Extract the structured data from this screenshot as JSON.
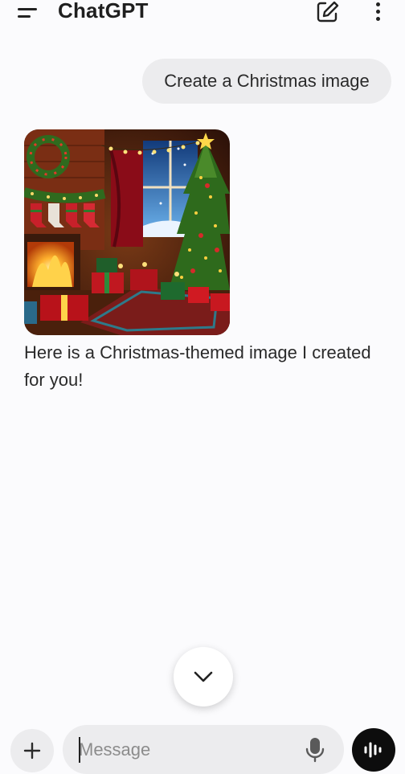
{
  "header": {
    "title": "ChatGPT",
    "icons": {
      "menu": "menu-icon",
      "new_chat": "edit-icon",
      "more": "more-vertical-icon"
    }
  },
  "conversation": {
    "user_message": "Create a Christmas image",
    "assistant_text": "Here is a Christmas-themed image I created for you!",
    "image_subject": "christmas-living-room-illustration"
  },
  "composer": {
    "placeholder": "Message",
    "icons": {
      "attach": "plus-icon",
      "dictate": "microphone-icon",
      "voice": "voice-waveform-icon",
      "scroll": "chevron-down-icon"
    }
  },
  "colors": {
    "background": "#fbfbfd",
    "bubble": "#ececee",
    "voice_button": "#0d0d0d"
  }
}
